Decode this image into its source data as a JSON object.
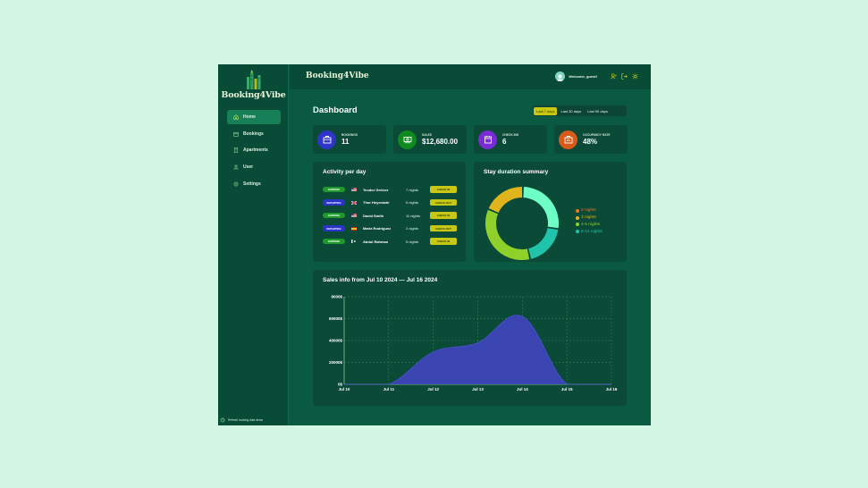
{
  "sidebar": {
    "logo_text": "Booking4Vibe",
    "items": [
      {
        "label": "Home",
        "icon": "home-icon",
        "active": true
      },
      {
        "label": "Bookings",
        "icon": "calendar-icon",
        "active": false
      },
      {
        "label": "Apartments",
        "icon": "building-icon",
        "active": false
      },
      {
        "label": "User",
        "icon": "user-icon",
        "active": false
      },
      {
        "label": "Settings",
        "icon": "gear-icon",
        "active": false
      }
    ],
    "footer_text": "Refresh booking data demo"
  },
  "header": {
    "brand": "Booking4Vibe",
    "welcome": "Welcome, guest!"
  },
  "dashboard": {
    "title": "Dashboard",
    "filters": [
      "Last 7 days",
      "Last 30 days",
      "Last 90 days"
    ],
    "active_filter": "Last 7 days"
  },
  "stats": [
    {
      "label": "BOOKINGS",
      "value": "11",
      "color": "#2f35c8",
      "icon": "briefcase-icon"
    },
    {
      "label": "SALES",
      "value": "$12,680.00",
      "color": "#0f8a1f",
      "icon": "banknote-icon"
    },
    {
      "label": "CHECK INS",
      "value": "6",
      "color": "#7a2ad6",
      "icon": "calendar-icon"
    },
    {
      "label": "OCCUPANCY RATE",
      "value": "48%",
      "color": "#d85a1a",
      "icon": "chart-icon"
    }
  ],
  "activity": {
    "title": "Activity per day",
    "rows": [
      {
        "status": "ARRIVING",
        "flag": "us",
        "name": "Teodor Grelser",
        "nights": "7 nights",
        "action": "CHECK IN"
      },
      {
        "status": "DEPARTING",
        "flag": "gb",
        "name": "Thor Heyerdahl",
        "nights": "5 nights",
        "action": "CHECK OUT"
      },
      {
        "status": "ARRIVING",
        "flag": "us",
        "name": "David Smith",
        "nights": "11 nights",
        "action": "CHECK IN"
      },
      {
        "status": "DEPARTING",
        "flag": "es",
        "name": "Maria Rodriguez",
        "nights": "2 nights",
        "action": "CHECK OUT"
      },
      {
        "status": "ARRIVING",
        "flag": "pk",
        "name": "Abdul Rahman",
        "nights": "5 nights",
        "action": "CHECK IN"
      }
    ]
  },
  "colors": {
    "arriving": "#1f9a2a",
    "departing": "#2a34c8",
    "action": "#c8c814",
    "area_fill": "#3d44b8",
    "area_stroke": "#4a52d0"
  },
  "stay_summary": {
    "title": "Stay duration summary",
    "legend": [
      {
        "label": "2 nights",
        "color": "#e8752a"
      },
      {
        "label": "3 nights",
        "color": "#e0b41c"
      },
      {
        "label": "4-5 nights",
        "color": "#8fd12a"
      },
      {
        "label": "6-14 nights",
        "color": "#1fc4aa"
      }
    ]
  },
  "chart_data": [
    {
      "type": "pie",
      "title": "Stay duration summary",
      "categories": [
        "4-5 nights",
        "6-14 nights",
        "3 nights",
        "6-14 nights"
      ],
      "values": [
        27,
        19,
        35,
        19
      ],
      "colors": [
        "#6effc6",
        "#1fc4aa",
        "#8fd12a",
        "#e0b41c"
      ],
      "legend_position": "right"
    },
    {
      "type": "area",
      "title": "Sales info from Jul 10 2024 — Jul 16 2024",
      "categories": [
        "Jul 10",
        "Jul 11",
        "Jul 12",
        "Jul 13",
        "Jul 14",
        "Jul 15",
        "Jul 16"
      ],
      "series": [
        {
          "values": [
            0,
            0,
            29500,
            38000,
            62000,
            0,
            0
          ]
        }
      ],
      "ylim": [
        0,
        80000
      ],
      "yticks": [
        "0$",
        "20000$",
        "40000$",
        "60000$",
        "8000$"
      ],
      "grid": true
    }
  ]
}
